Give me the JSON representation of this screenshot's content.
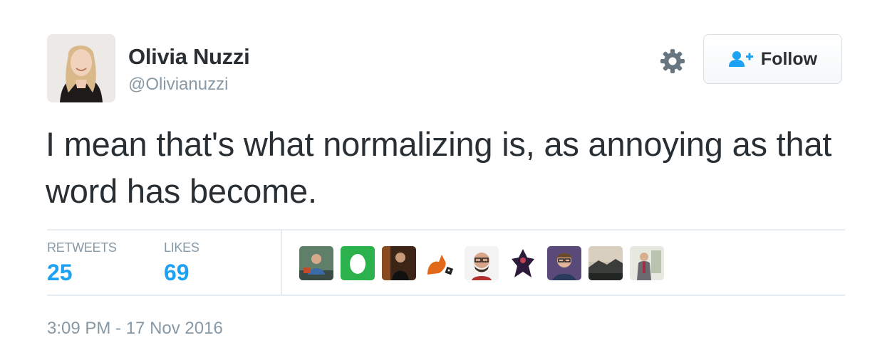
{
  "user": {
    "display_name": "Olivia Nuzzi",
    "handle": "@Olivianuzzi",
    "avatar_icon": "profile-photo"
  },
  "actions": {
    "follow_label": "Follow",
    "follow_icon": "person-add-icon",
    "settings_icon": "gear-icon"
  },
  "tweet": {
    "text": "I mean that's what normalizing is, as annoying as that word has become."
  },
  "stats": {
    "retweets_label": "RETWEETS",
    "retweets_value": "25",
    "likes_label": "LIKES",
    "likes_value": "69"
  },
  "likers_count_shown": 9,
  "timestamp": "3:09 PM - 17 Nov 2016",
  "colors": {
    "text": "#292f33",
    "muted": "#8899a6",
    "accent": "#1da1f2",
    "divider": "#e6ecf0"
  }
}
